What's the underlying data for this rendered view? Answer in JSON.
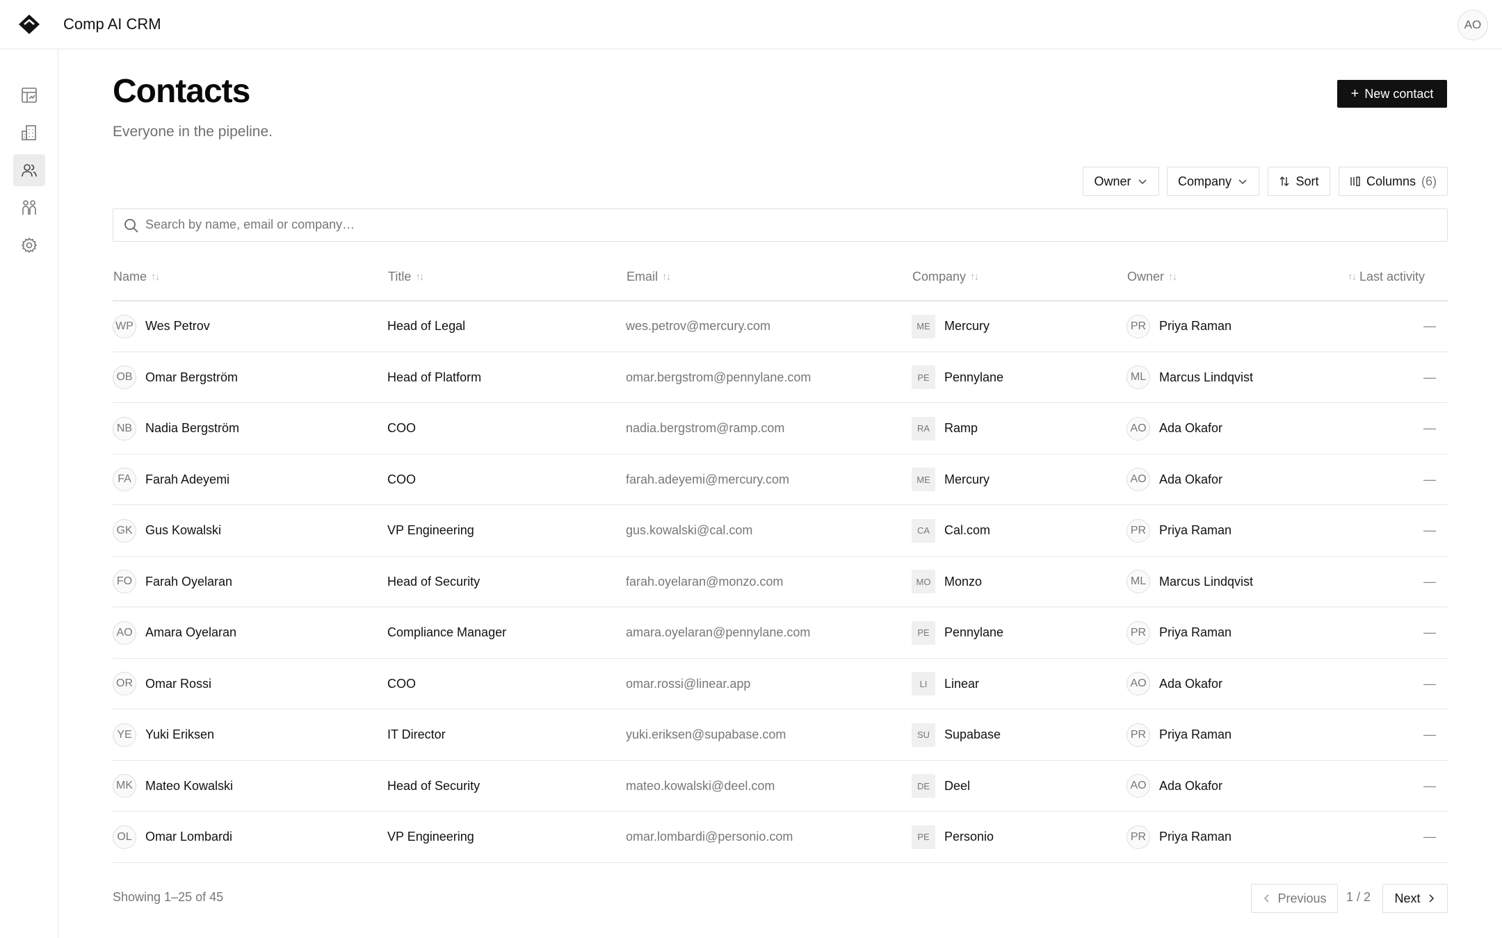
{
  "app": {
    "title": "Comp AI CRM",
    "user_initials": "AO"
  },
  "sidebar": {
    "items": [
      {
        "name": "dashboard",
        "icon": "dashboard-icon",
        "active": false
      },
      {
        "name": "companies",
        "icon": "building-icon",
        "active": false
      },
      {
        "name": "contacts",
        "icon": "users-icon",
        "active": true
      },
      {
        "name": "team",
        "icon": "people-icon",
        "active": false
      },
      {
        "name": "settings",
        "icon": "gear-icon",
        "active": false
      }
    ]
  },
  "page": {
    "title": "Contacts",
    "subtitle": "Everyone in the pipeline.",
    "new_button": {
      "icon": "+",
      "label": "New contact"
    }
  },
  "toolbar": {
    "owner_label": "Owner",
    "company_label": "Company",
    "sort_label": "Sort",
    "columns_label": "Columns",
    "columns_count": "(6)"
  },
  "search": {
    "placeholder": "Search by name, email or company…",
    "value": ""
  },
  "table": {
    "columns": [
      "Name",
      "Title",
      "Email",
      "Company",
      "Owner",
      "Last activity"
    ],
    "rows": [
      {
        "initials": "WP",
        "name": "Wes Petrov",
        "title": "Head of Legal",
        "email": "wes.petrov@mercury.com",
        "company_abbr": "ME",
        "company": "Mercury",
        "owner_initials": "PR",
        "owner": "Priya Raman",
        "last_activity": "—"
      },
      {
        "initials": "OB",
        "name": "Omar Bergström",
        "title": "Head of Platform",
        "email": "omar.bergstrom@pennylane.com",
        "company_abbr": "PE",
        "company": "Pennylane",
        "owner_initials": "ML",
        "owner": "Marcus Lindqvist",
        "last_activity": "—"
      },
      {
        "initials": "NB",
        "name": "Nadia Bergström",
        "title": "COO",
        "email": "nadia.bergstrom@ramp.com",
        "company_abbr": "RA",
        "company": "Ramp",
        "owner_initials": "AO",
        "owner": "Ada Okafor",
        "last_activity": "—"
      },
      {
        "initials": "FA",
        "name": "Farah Adeyemi",
        "title": "COO",
        "email": "farah.adeyemi@mercury.com",
        "company_abbr": "ME",
        "company": "Mercury",
        "owner_initials": "AO",
        "owner": "Ada Okafor",
        "last_activity": "—"
      },
      {
        "initials": "GK",
        "name": "Gus Kowalski",
        "title": "VP Engineering",
        "email": "gus.kowalski@cal.com",
        "company_abbr": "CA",
        "company": "Cal.com",
        "owner_initials": "PR",
        "owner": "Priya Raman",
        "last_activity": "—"
      },
      {
        "initials": "FO",
        "name": "Farah Oyelaran",
        "title": "Head of Security",
        "email": "farah.oyelaran@monzo.com",
        "company_abbr": "MO",
        "company": "Monzo",
        "owner_initials": "ML",
        "owner": "Marcus Lindqvist",
        "last_activity": "—"
      },
      {
        "initials": "AO",
        "name": "Amara Oyelaran",
        "title": "Compliance Manager",
        "email": "amara.oyelaran@pennylane.com",
        "company_abbr": "PE",
        "company": "Pennylane",
        "owner_initials": "PR",
        "owner": "Priya Raman",
        "last_activity": "—"
      },
      {
        "initials": "OR",
        "name": "Omar Rossi",
        "title": "COO",
        "email": "omar.rossi@linear.app",
        "company_abbr": "LI",
        "company": "Linear",
        "owner_initials": "AO",
        "owner": "Ada Okafor",
        "last_activity": "—"
      },
      {
        "initials": "YE",
        "name": "Yuki Eriksen",
        "title": "IT Director",
        "email": "yuki.eriksen@supabase.com",
        "company_abbr": "SU",
        "company": "Supabase",
        "owner_initials": "PR",
        "owner": "Priya Raman",
        "last_activity": "—"
      },
      {
        "initials": "MK",
        "name": "Mateo Kowalski",
        "title": "Head of Security",
        "email": "mateo.kowalski@deel.com",
        "company_abbr": "DE",
        "company": "Deel",
        "owner_initials": "AO",
        "owner": "Ada Okafor",
        "last_activity": "—"
      },
      {
        "initials": "OL",
        "name": "Omar Lombardi",
        "title": "VP Engineering",
        "email": "omar.lombardi@personio.com",
        "company_abbr": "PE",
        "company": "Personio",
        "owner_initials": "PR",
        "owner": "Priya Raman",
        "last_activity": "—"
      }
    ]
  },
  "footer": {
    "showing": "Showing 1–25 of 45",
    "previous_label": "Previous",
    "page_indicator": "1 / 2",
    "next_label": "Next"
  }
}
